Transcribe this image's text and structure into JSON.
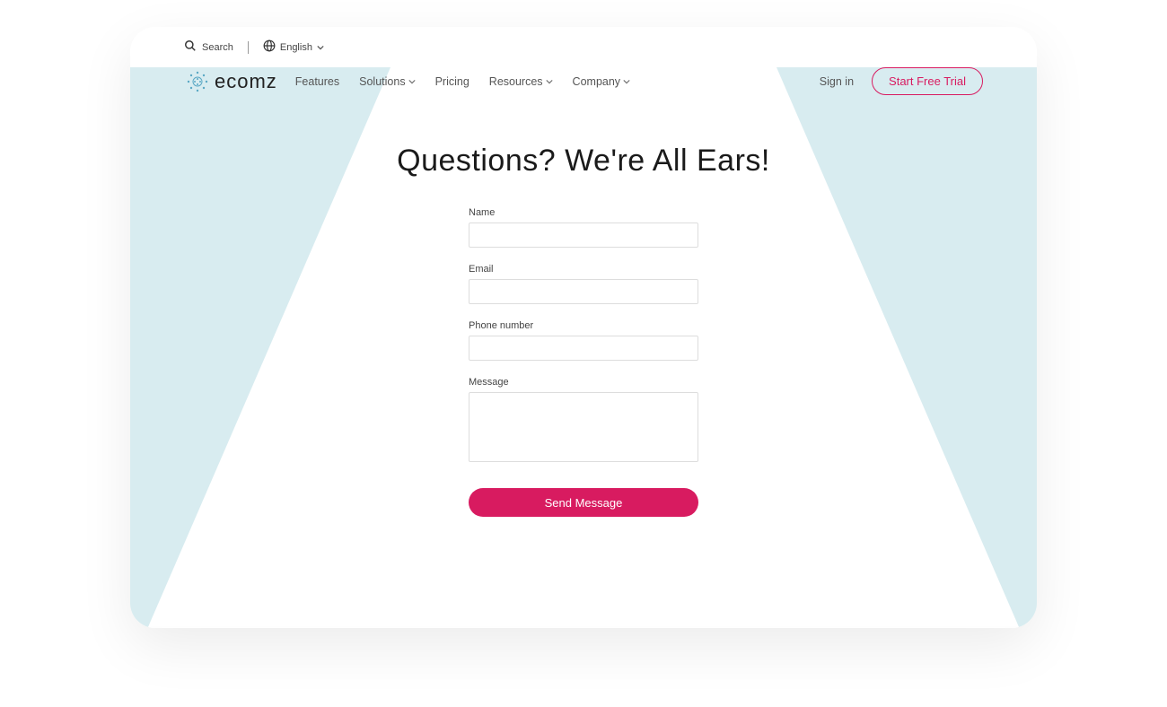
{
  "topbar": {
    "search_label": "Search",
    "language_label": "English"
  },
  "logo": {
    "text": "ecomz"
  },
  "nav": {
    "items": [
      {
        "label": "Features",
        "has_dropdown": false
      },
      {
        "label": "Solutions",
        "has_dropdown": true
      },
      {
        "label": "Pricing",
        "has_dropdown": false
      },
      {
        "label": "Resources",
        "has_dropdown": true
      },
      {
        "label": "Company",
        "has_dropdown": true
      }
    ],
    "signin_label": "Sign in",
    "cta_label": "Start Free Trial"
  },
  "page": {
    "heading": "Questions? We're All Ears!"
  },
  "form": {
    "name_label": "Name",
    "email_label": "Email",
    "phone_label": "Phone number",
    "message_label": "Message",
    "submit_label": "Send Message"
  },
  "colors": {
    "accent": "#d81b60",
    "triangle": "rgba(115, 186, 202, 0.28)"
  }
}
